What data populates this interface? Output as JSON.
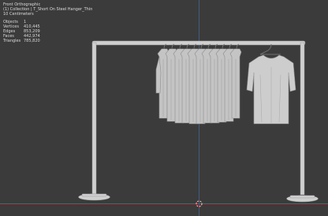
{
  "viewport": {
    "view_name": "Front Orthographic",
    "collection": "(1) Collection | T_Short On Steel Hanger_Thin",
    "units": "10 Centimeters"
  },
  "stats": [
    {
      "label": "Objects",
      "value": "1"
    },
    {
      "label": "Vertices",
      "value": "410,445"
    },
    {
      "label": "Edges",
      "value": "853,209"
    },
    {
      "label": "Faces",
      "value": "442,974"
    },
    {
      "label": "Triangles",
      "value": "785,820"
    }
  ],
  "colors": {
    "background": "#3b3b3b",
    "x_axis": "#b8334a",
    "z_axis": "#3d5e8a",
    "mesh": "#c9c9c9"
  }
}
